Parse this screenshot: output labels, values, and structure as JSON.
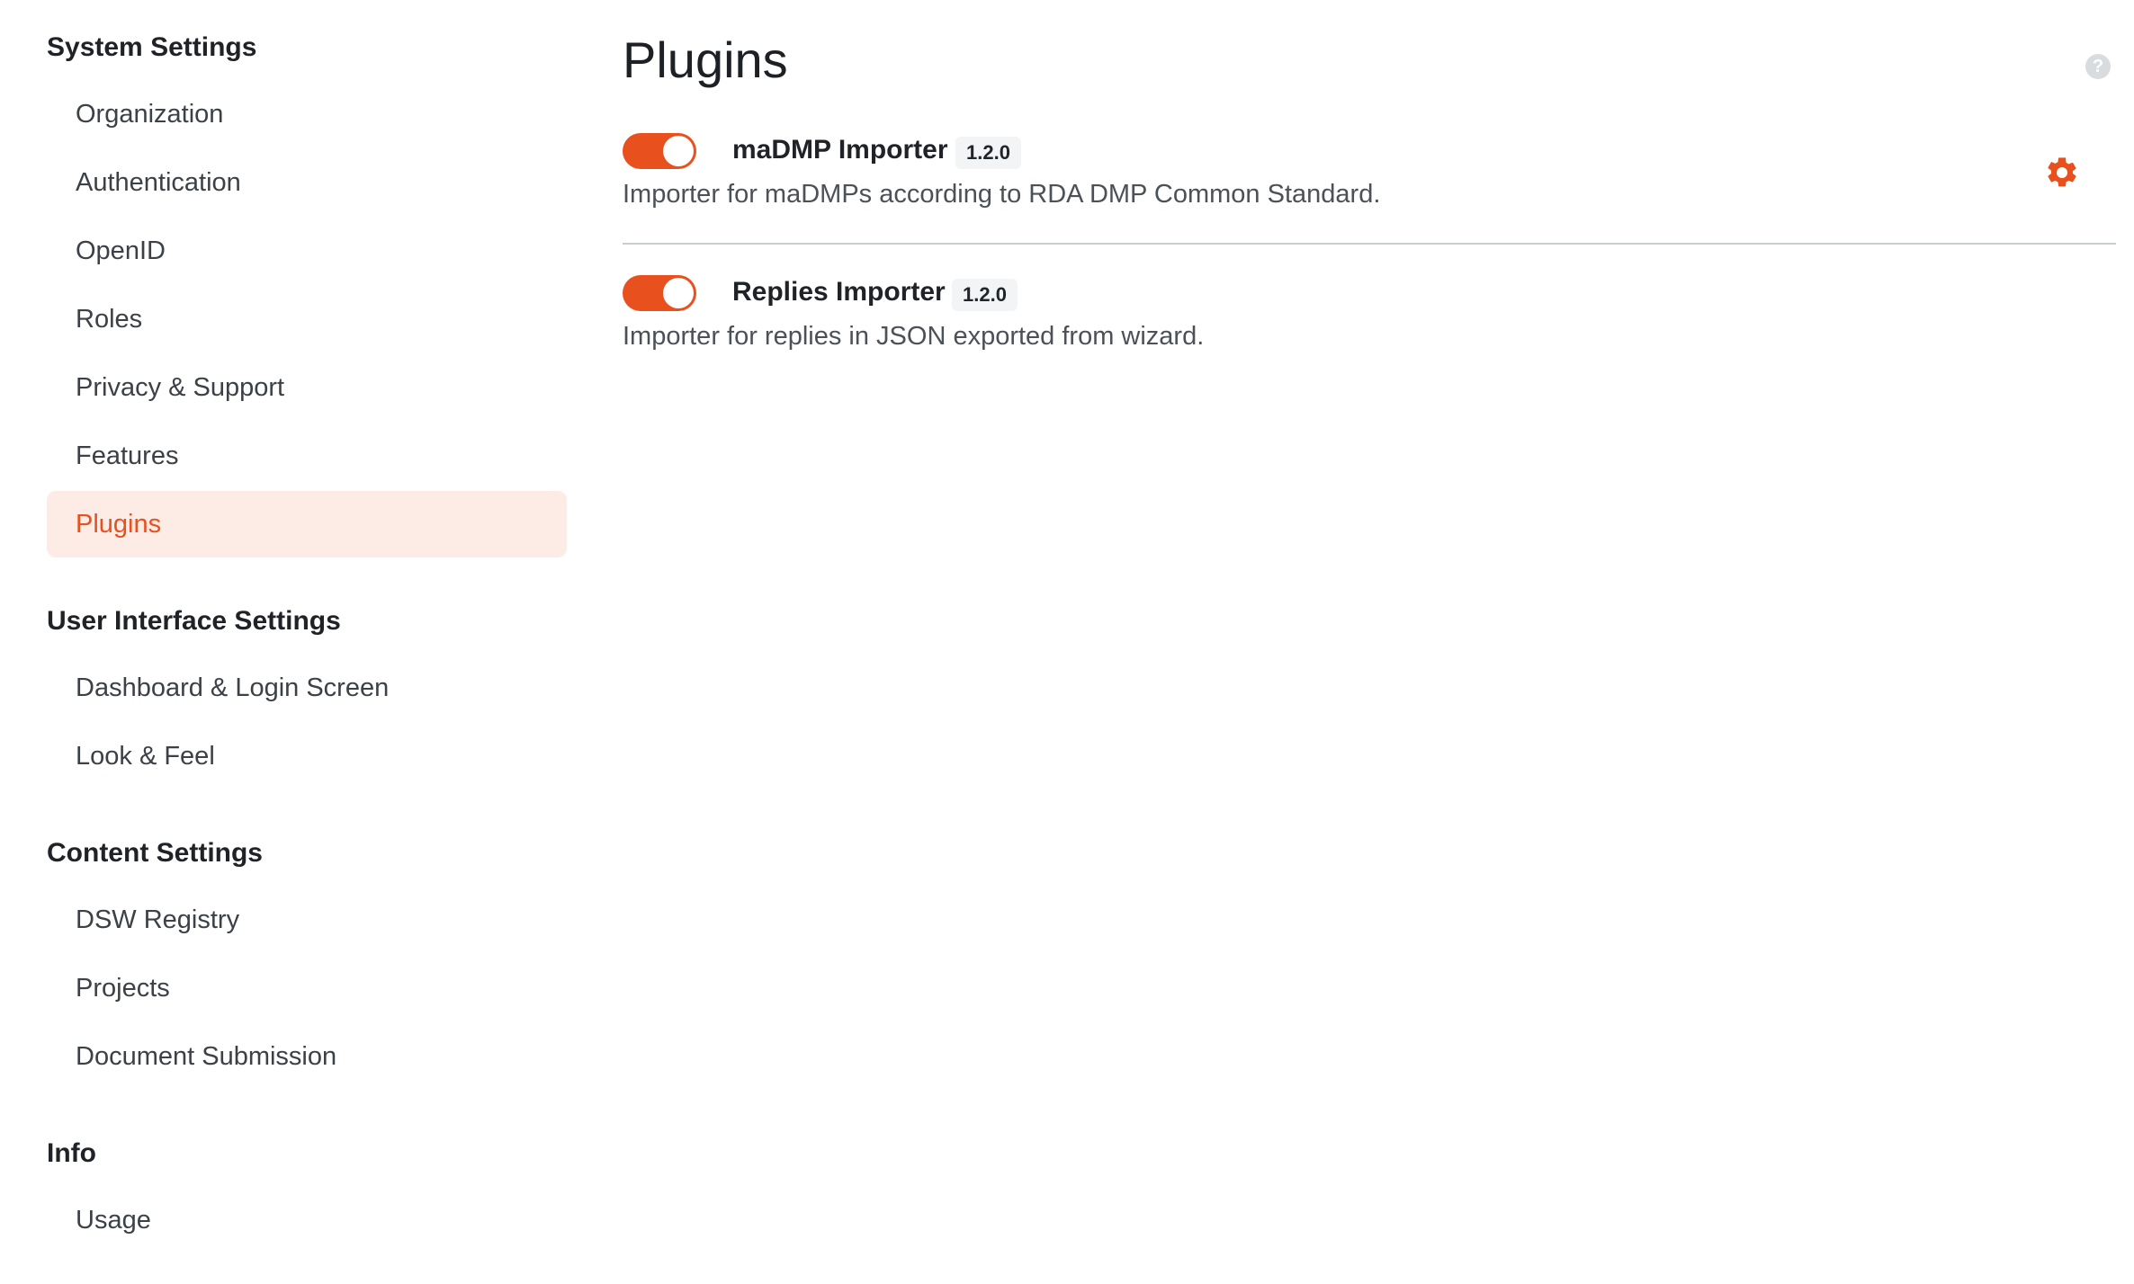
{
  "sidebar": {
    "groups": [
      {
        "title": "System Settings",
        "items": [
          {
            "label": "Organization"
          },
          {
            "label": "Authentication"
          },
          {
            "label": "OpenID"
          },
          {
            "label": "Roles"
          },
          {
            "label": "Privacy & Support"
          },
          {
            "label": "Features"
          },
          {
            "label": "Plugins",
            "active": true
          }
        ]
      },
      {
        "title": "User Interface Settings",
        "items": [
          {
            "label": "Dashboard & Login Screen"
          },
          {
            "label": "Look & Feel"
          }
        ]
      },
      {
        "title": "Content Settings",
        "items": [
          {
            "label": "DSW Registry"
          },
          {
            "label": "Projects"
          },
          {
            "label": "Document Submission"
          }
        ]
      },
      {
        "title": "Info",
        "items": [
          {
            "label": "Usage"
          }
        ]
      }
    ]
  },
  "main": {
    "title": "Plugins",
    "help_icon": "?",
    "plugins": [
      {
        "name": "maDMP Importer",
        "version": "1.2.0",
        "description": "Importer for maDMPs according to RDA DMP Common Standard.",
        "enabled": true,
        "has_settings": true
      },
      {
        "name": "Replies Importer",
        "version": "1.2.0",
        "description": "Importer for replies in JSON exported from wizard.",
        "enabled": true,
        "has_settings": false
      }
    ]
  },
  "colors": {
    "accent": "#e8501e",
    "active_bg": "#fdece6"
  }
}
